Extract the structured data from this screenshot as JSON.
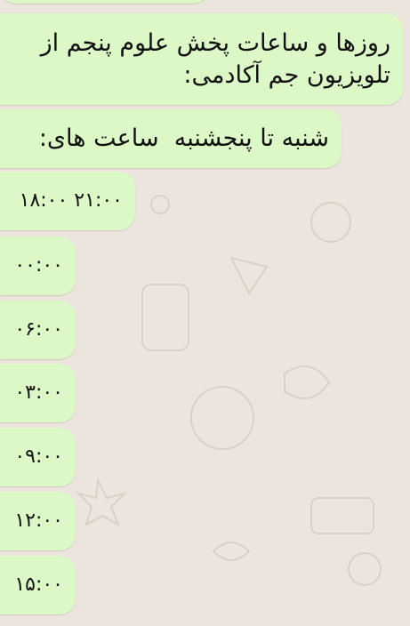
{
  "chat": {
    "messages": [
      {
        "text": "روزها و ساعات پخش علوم پنجم از تلویزیون جم آکادمی:"
      },
      {
        "text": "شنبه تا پنجشنبه  ساعت های:"
      },
      {
        "text": "۱۸:۰۰ ۲۱:۰۰"
      },
      {
        "text": "۰۰:۰۰"
      },
      {
        "text": "۰۶:۰۰"
      },
      {
        "text": "۰۳:۰۰"
      },
      {
        "text": "۰۹:۰۰"
      },
      {
        "text": "۱۲:۰۰"
      },
      {
        "text": "۱۵:۰۰"
      }
    ]
  },
  "colors": {
    "background": "#ECE5DD",
    "outgoing_bubble": "#DCF8C6"
  }
}
